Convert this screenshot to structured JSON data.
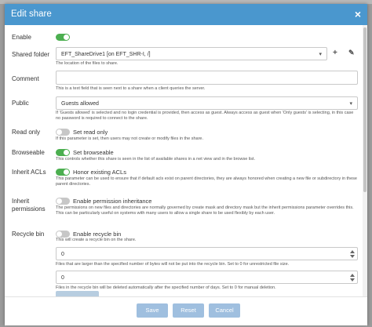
{
  "dialog": {
    "title": "Edit share",
    "close_glyph": "×",
    "colors": {
      "titlebar": "#4a97ce",
      "toggle_on": "#4caf50",
      "toggle_off": "#c7c7c7",
      "button": "#9fbfdf"
    }
  },
  "enable": {
    "label": "Enable",
    "on": true
  },
  "shared_folder": {
    "label": "Shared folder",
    "value": "EFT_ShareDrive1 [on EFT_SHR-I, /]",
    "help": "The location of the files to share.",
    "icons": [
      "chevron-down-icon",
      "plus-icon",
      "edit-pencil-icon"
    ]
  },
  "comment": {
    "label": "Comment",
    "value": "",
    "help": "This is a text field that is seen next to a share when a client queries the server."
  },
  "public": {
    "label": "Public",
    "value": "Guests allowed",
    "help": "If 'Guests allowed' is selected and no login credential is provided, then access as guest. Always access as guest when 'Only guests' is selecting, in this case no password is required to connect to the share."
  },
  "read_only": {
    "label": "Read only",
    "toggle_label": "Set read only",
    "on": false,
    "help": "If this parameter is set, then users may not create or modify files in the share."
  },
  "browseable": {
    "label": "Browseable",
    "toggle_label": "Set browseable",
    "on": true,
    "help": "This controls whether this share is seen in the list of available shares in a net view and in the browse list."
  },
  "inherit_acls": {
    "label": "Inherit ACLs",
    "toggle_label": "Honor existing ACLs",
    "on": true,
    "help": "This parameter can be used to ensure that if default acls exist on parent directories, they are always honored when creating a new file or subdirectory in these parent directories."
  },
  "inherit_permissions": {
    "label_line1": "Inherit",
    "label_line2": "permissions",
    "toggle_label": "Enable permission inheritance",
    "on": false,
    "help": "The permissions on new files and directories are normally governed by create mask and directory mask but the inherit permissions parameter overrides this. This can be particularly useful on systems with many users to allow a single share to be used flexibly by each user."
  },
  "recycle_bin": {
    "label": "Recycle bin",
    "toggle_label": "Enable recycle bin",
    "on": false,
    "help": "This will create a recycle bin on the share.",
    "max_size_value": "0",
    "max_size_help": "Files that are larger than the specified number of bytes will not be put into the recycle bin. Set to 0 for unrestricted file size.",
    "days_value": "0",
    "days_help": "Files in the recycle bin will be deleted automatically after the specified number of days. Set to 0 for manual deletion."
  },
  "footer": {
    "save_label": "Save",
    "reset_label": "Reset",
    "cancel_label": "Cancel"
  }
}
